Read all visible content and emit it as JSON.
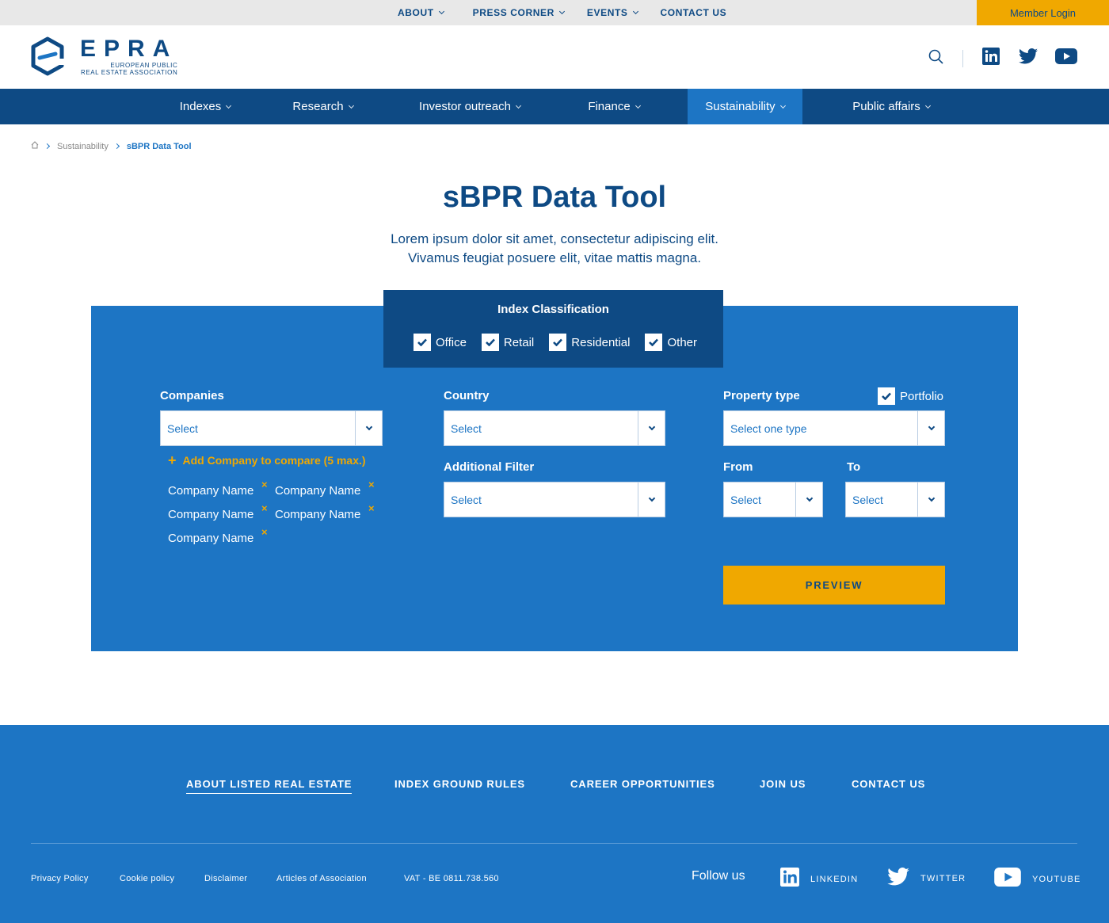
{
  "topbar": {
    "items": [
      {
        "label": "ABOUT",
        "has_menu": true
      },
      {
        "label": "PRESS CORNER",
        "has_menu": true
      },
      {
        "label": "EVENTS",
        "has_menu": true
      },
      {
        "label": "CONTACT US",
        "has_menu": false
      }
    ],
    "member_login": "Member Login"
  },
  "logo": {
    "wordmark": "EPRA",
    "line1": "EUROPEAN PUBLIC",
    "line2": "REAL ESTATE ASSOCIATION"
  },
  "header_icons": [
    "search-icon",
    "linkedin-icon",
    "twitter-icon",
    "youtube-icon"
  ],
  "mainnav": {
    "items": [
      {
        "label": "Indexes"
      },
      {
        "label": "Research"
      },
      {
        "label": "Investor outreach"
      },
      {
        "label": "Finance"
      },
      {
        "label": "Sustainability",
        "active": true
      },
      {
        "label": "Public affairs"
      }
    ]
  },
  "breadcrumb": {
    "items": [
      "Sustainability",
      "sBPR Data Tool"
    ]
  },
  "page": {
    "title": "sBPR Data Tool",
    "lead_line1": "Lorem ipsum dolor sit amet, consectetur adipiscing elit.",
    "lead_line2": "Vivamus feugiat posuere elit, vitae mattis magna."
  },
  "classification": {
    "title": "Index Classification",
    "options": [
      {
        "label": "Office",
        "checked": true
      },
      {
        "label": "Retail",
        "checked": true
      },
      {
        "label": "Residential",
        "checked": true
      },
      {
        "label": "Other",
        "checked": true
      }
    ]
  },
  "form": {
    "companies_label": "Companies",
    "companies_value": "Select",
    "add_company": "Add Company to compare (5 max.)",
    "selected_companies": [
      "Company Name",
      "Company Name",
      "Company Name",
      "Company Name",
      "Company Name"
    ],
    "remove_glyph": "×",
    "country_label": "Country",
    "country_value": "Select",
    "additional_label": "Additional Filter",
    "additional_value": "Select",
    "property_label": "Property type",
    "portfolio_label": "Portfolio",
    "portfolio_checked": true,
    "property_value": "Select one type",
    "from_label": "From",
    "from_value": "Select",
    "to_label": "To",
    "to_value": "Select",
    "preview": "PREVIEW"
  },
  "footer": {
    "links": [
      {
        "label": "ABOUT LISTED REAL ESTATE",
        "active": true
      },
      {
        "label": "INDEX GROUND RULES"
      },
      {
        "label": "CAREER OPPORTUNITIES"
      },
      {
        "label": "JOIN US"
      },
      {
        "label": "CONTACT US"
      }
    ],
    "legal": [
      "Privacy Policy",
      "Cookie policy",
      "Disclaimer",
      "Articles of Association",
      "VAT - BE 0811.738.560"
    ],
    "follow": "Follow us",
    "social": [
      {
        "label": "LINKEDIN",
        "icon": "linkedin-icon"
      },
      {
        "label": "TWITTER",
        "icon": "twitter-icon"
      },
      {
        "label": "YOUTUBE",
        "icon": "youtube-icon"
      }
    ]
  },
  "colors": {
    "navy": "#0e4a84",
    "blue": "#1d75c4",
    "gold": "#f0a800",
    "topbar": "#e8e8e8"
  }
}
